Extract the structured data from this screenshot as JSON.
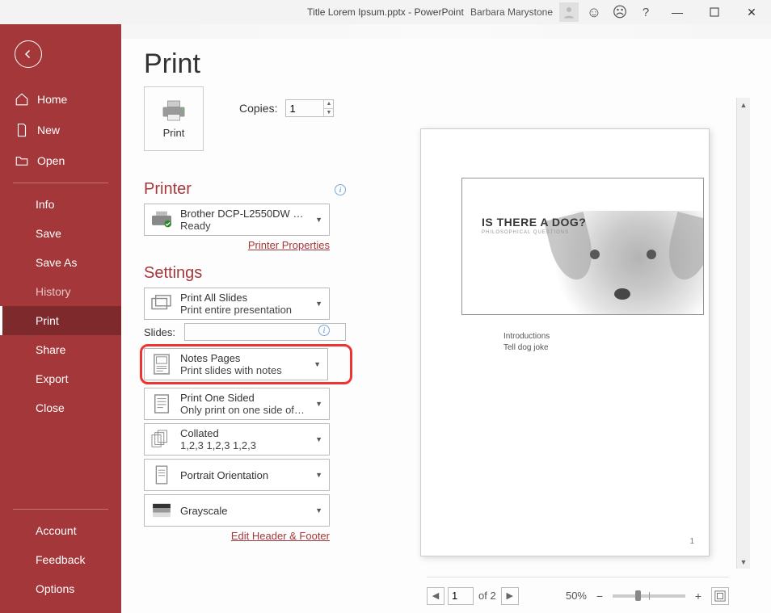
{
  "titlebar": {
    "doc_title": "Title Lorem Ipsum.pptx  -  PowerPoint",
    "username": "Barbara Marystone"
  },
  "sidebar": {
    "home": "Home",
    "new": "New",
    "open": "Open",
    "info": "Info",
    "save": "Save",
    "save_as": "Save As",
    "history": "History",
    "print": "Print",
    "share": "Share",
    "export": "Export",
    "close": "Close",
    "account": "Account",
    "feedback": "Feedback",
    "options": "Options"
  },
  "page": {
    "title": "Print",
    "print_button": "Print",
    "copies_label": "Copies:",
    "copies_value": "1"
  },
  "printer": {
    "heading": "Printer",
    "name": "Brother DCP-L2550DW serie...",
    "status": "Ready",
    "properties_link": "Printer Properties"
  },
  "settings": {
    "heading": "Settings",
    "print_what": {
      "title": "Print All Slides",
      "sub": "Print entire presentation"
    },
    "slides_label": "Slides:",
    "layout": {
      "title": "Notes Pages",
      "sub": "Print slides with notes"
    },
    "sided": {
      "title": "Print One Sided",
      "sub": "Only print on one side of th..."
    },
    "collated": {
      "title": "Collated",
      "sub": "1,2,3    1,2,3    1,2,3"
    },
    "orientation": {
      "title": "Portrait Orientation"
    },
    "color": {
      "title": "Grayscale"
    },
    "edit_header_link": "Edit Header & Footer"
  },
  "preview": {
    "slide_title": "IS THERE A DOG?",
    "slide_subtitle": "PHILOSOPHICAL QUESTIONS",
    "notes_line1": "Introductions",
    "notes_line2": "Tell dog joke",
    "page_number": "1"
  },
  "nav": {
    "current_page": "1",
    "of_text": "of 2",
    "zoom_pct": "50%"
  }
}
